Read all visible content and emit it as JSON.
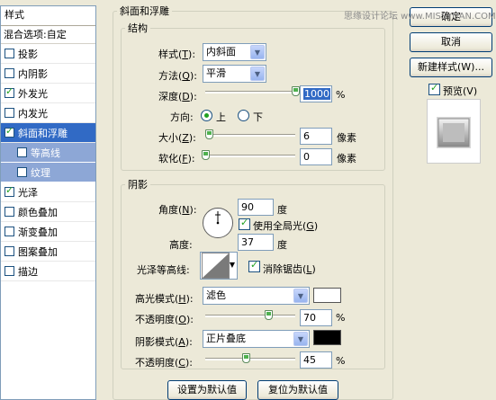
{
  "watermark": "思缘设计论坛 www.MISSYUAN.COM",
  "sidebar": {
    "header": "样式",
    "blend_options": "混合选项:自定",
    "items": [
      {
        "label": "投影",
        "checked": false
      },
      {
        "label": "内阴影",
        "checked": false
      },
      {
        "label": "外发光",
        "checked": true
      },
      {
        "label": "内发光",
        "checked": false
      },
      {
        "label": "斜面和浮雕",
        "checked": true,
        "active": true
      },
      {
        "label": "等高线",
        "checked": false,
        "sub": true
      },
      {
        "label": "纹理",
        "checked": false,
        "sub": true
      },
      {
        "label": "光泽",
        "checked": true
      },
      {
        "label": "颜色叠加",
        "checked": false
      },
      {
        "label": "渐变叠加",
        "checked": false
      },
      {
        "label": "图案叠加",
        "checked": false
      },
      {
        "label": "描边",
        "checked": false
      }
    ]
  },
  "bevel": {
    "title": "斜面和浮雕",
    "structure": {
      "title": "结构",
      "style_label": "样式",
      "style_key": "T",
      "style_value": "内斜面",
      "technique_label": "方法",
      "technique_key": "Q",
      "technique_value": "平滑",
      "depth_label": "深度",
      "depth_key": "D",
      "depth_value": "1000",
      "depth_slider": 1.0,
      "percent": "%",
      "direction_label": "方向:",
      "dir_up": "上",
      "dir_down": "下",
      "size_label": "大小",
      "size_key": "Z",
      "size_value": "6",
      "size_slider": 0.04,
      "soften_label": "软化",
      "soften_key": "F",
      "soften_value": "0",
      "soften_slider": 0.0,
      "pixels": "像素"
    },
    "shading": {
      "title": "阴影",
      "angle_label": "角度",
      "angle_key": "N",
      "angle_value": "90",
      "degree": "度",
      "global_light_label": "使用全局光",
      "global_light_key": "G",
      "global_light": true,
      "altitude_label": "高度:",
      "altitude_value": "37",
      "gloss_label": "光泽等高线:",
      "antialias_label": "消除锯齿",
      "antialias_key": "L",
      "antialias": true,
      "highlight_label": "高光模式",
      "highlight_key": "H",
      "highlight_mode": "滤色",
      "highlight_color": "#ffffff",
      "hl_opacity_label": "不透明度",
      "hl_opacity_key": "O",
      "hl_opacity_value": "70",
      "hl_opacity_slider": 0.7,
      "shadow_label": "阴影模式",
      "shadow_key": "A",
      "shadow_mode": "正片叠底",
      "shadow_color": "#000000",
      "sh_opacity_label": "不透明度",
      "sh_opacity_key": "C",
      "sh_opacity_value": "45",
      "sh_opacity_slider": 0.45
    }
  },
  "buttons": {
    "ok": "确定",
    "cancel": "取消",
    "new_style": "新建样式(W)...",
    "preview": "预览(V)",
    "make_default": "设置为默认值",
    "reset_default": "复位为默认值"
  }
}
